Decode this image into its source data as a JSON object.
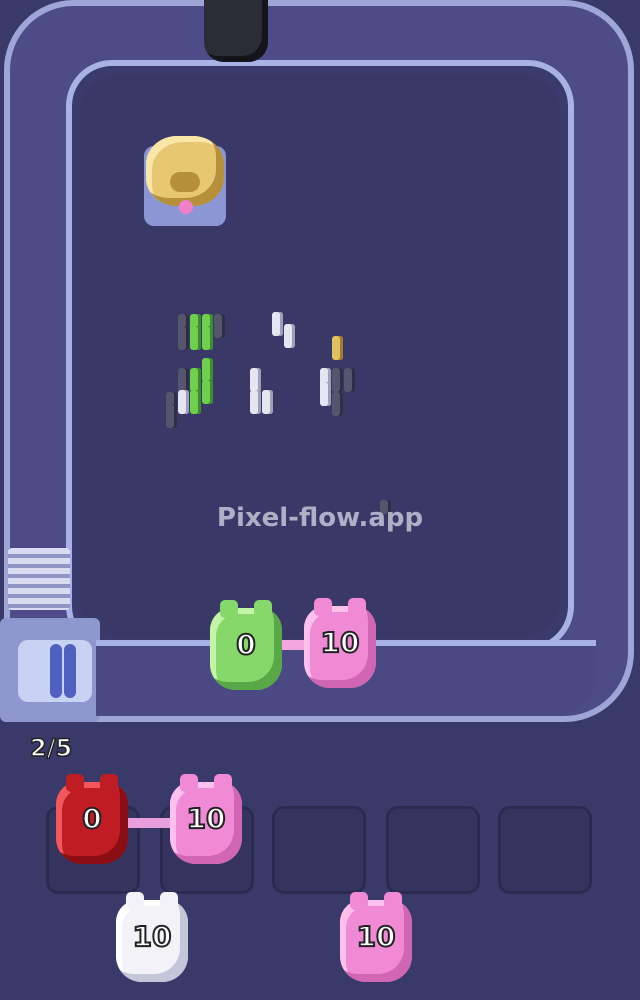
{
  "watermark": {
    "text": "Pixel-flow.app"
  },
  "queue": {
    "counter": "2/5"
  },
  "conveyor_pigs": [
    {
      "color": "green",
      "count": "0"
    },
    {
      "color": "pink",
      "count": "10"
    }
  ],
  "slot_pigs": [
    {
      "color": "red",
      "count": "0"
    },
    {
      "color": "pink",
      "count": "10"
    }
  ],
  "waiting_pigs": [
    {
      "color": "white",
      "count": "10"
    },
    {
      "color": "pink",
      "count": "10"
    }
  ],
  "slots": {
    "total": 5
  },
  "colors": {
    "green": "#86d86a",
    "pink": "#f08ad4",
    "red": "#c01c24",
    "white": "#f2f2f8",
    "gold": "#e7c772"
  }
}
